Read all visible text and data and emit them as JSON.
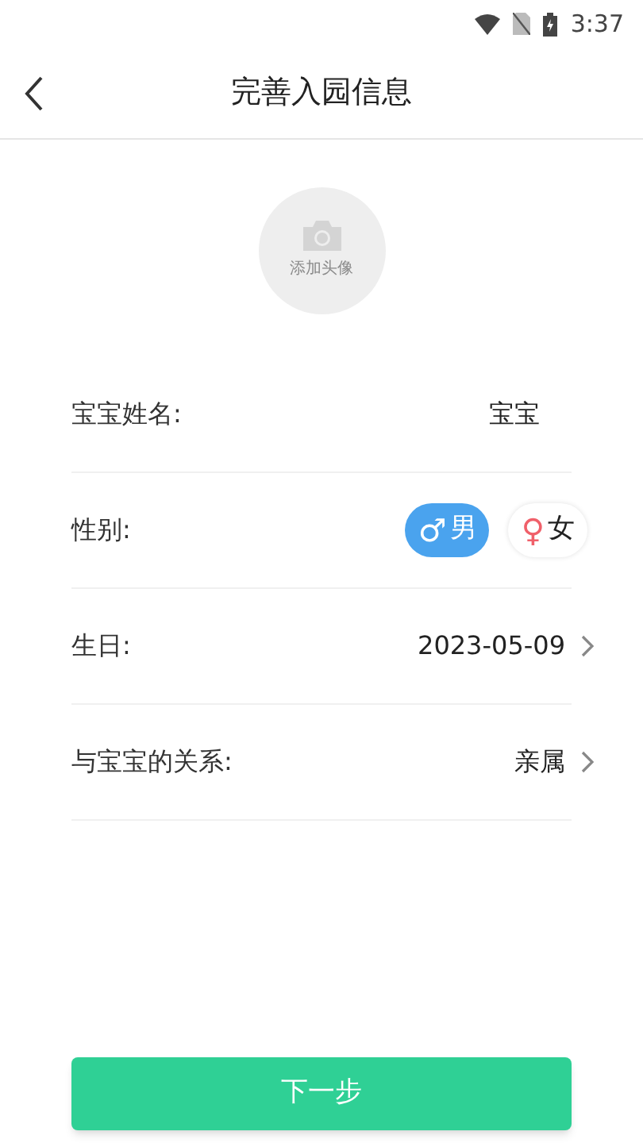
{
  "status_bar": {
    "time": "3:37"
  },
  "header": {
    "title": "完善入园信息"
  },
  "avatar": {
    "label": "添加头像"
  },
  "fields": [
    {
      "kind": "text",
      "label": "宝宝姓名:",
      "value": "宝宝"
    },
    {
      "kind": "gender",
      "label": "性别:",
      "options": [
        {
          "label": "男",
          "symbol": "♂",
          "selected": true
        },
        {
          "label": "女",
          "symbol": "♀",
          "selected": false
        }
      ]
    },
    {
      "kind": "select",
      "label": "生日:",
      "value": "2023-05-09"
    },
    {
      "kind": "select",
      "label": "与宝宝的关系:",
      "value": "亲属"
    }
  ],
  "next_button": {
    "label": "下一步"
  }
}
